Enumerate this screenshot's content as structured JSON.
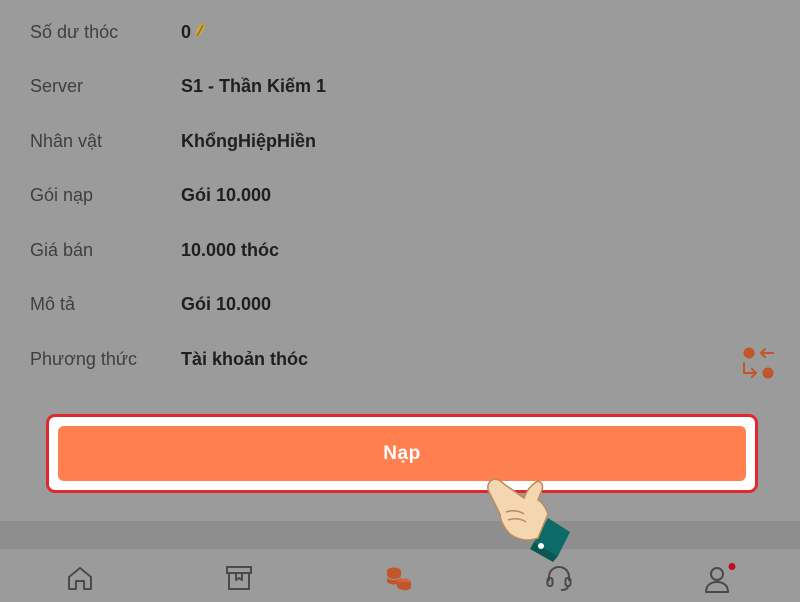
{
  "details": [
    {
      "label": "Số dư thóc",
      "value": "0",
      "icon": "grain-icon"
    },
    {
      "label": "Server",
      "value": "S1 - Thần Kiếm 1"
    },
    {
      "label": "Nhân vật",
      "value": "KhổngHiệpHiền"
    },
    {
      "label": "Gói nạp",
      "value": "Gói 10.000"
    },
    {
      "label": "Giá bán",
      "value": "10.000 thóc"
    },
    {
      "label": "Mô tả",
      "value": "Gói 10.000"
    },
    {
      "label": "Phương thức",
      "value": "Tài khoản thóc",
      "action_icon": "swap-icon"
    }
  ],
  "action": {
    "label": "Nạp"
  },
  "bottom_nav": {
    "items": [
      {
        "icon": "home-icon",
        "active": false
      },
      {
        "icon": "box-icon",
        "active": false
      },
      {
        "icon": "coins-icon",
        "active": true
      },
      {
        "icon": "headset-icon",
        "active": false
      },
      {
        "icon": "user-icon",
        "active": false,
        "has_notification_dot": true
      }
    ]
  },
  "overlay": {
    "icon": "pointing-hand-icon"
  },
  "colors": {
    "overlay_gray": "#9b9b9b",
    "primary": "#ff7f4f",
    "highlight_border": "#e0282e",
    "accent_icon": "#c0562a",
    "label_text": "#3f3f3f",
    "value_text": "#1f1f1f",
    "notification_dot": "#c0101a"
  }
}
